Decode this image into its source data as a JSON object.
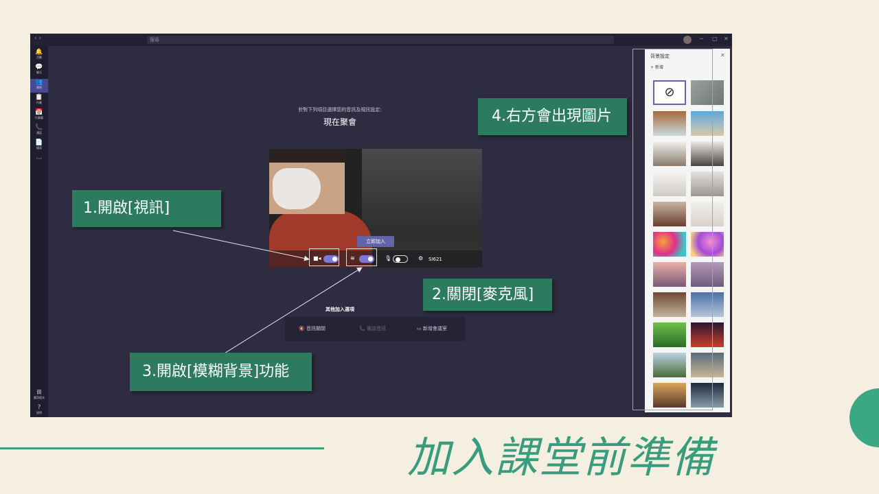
{
  "window": {
    "search_placeholder": "搜尋",
    "nav_arrows": "‹ ›",
    "controls": [
      "─",
      "▢",
      "✕"
    ]
  },
  "rail": {
    "items": [
      {
        "label": "活動",
        "icon": "bell-icon",
        "glyph": "🔔"
      },
      {
        "label": "聊天",
        "icon": "chat-icon",
        "glyph": "💬"
      },
      {
        "label": "團隊",
        "icon": "teams-icon",
        "glyph": "👥"
      },
      {
        "label": "作業",
        "icon": "assignments-icon",
        "glyph": "📋"
      },
      {
        "label": "行事曆",
        "icon": "calendar-icon",
        "glyph": "📅"
      },
      {
        "label": "通話",
        "icon": "phone-icon",
        "glyph": "📞"
      },
      {
        "label": "檔案",
        "icon": "files-icon",
        "glyph": "📄"
      }
    ],
    "more": "···",
    "apps_label": "應用程式",
    "help_label": "說明"
  },
  "prejoin": {
    "instruction": "針對下列項目選擇您的音訊及視訊設定:",
    "title": "現在聚會",
    "join_button": "立即加入",
    "device_label": "SI621",
    "video_on": true,
    "blur_on": true,
    "mic_on": false,
    "other_options_label": "其他加入選項",
    "options": [
      "音訊關閉",
      "電話音訊",
      "新增會議室"
    ]
  },
  "bg_panel": {
    "title": "背景設定",
    "add_label": "新增",
    "close": "✕",
    "none_symbol": "⊘"
  },
  "annotations": {
    "step1": "1.開啟[視訊]",
    "step2": "2.關閉[麥克風]",
    "step3": "3.開啟[模糊背景]功能",
    "step4": "4.右方會出現圖片"
  },
  "slide_title": "加入課堂前準備",
  "colors": {
    "accent": "#2c7b5e",
    "teams_purple": "#6264a7",
    "background": "#f4efe0"
  }
}
